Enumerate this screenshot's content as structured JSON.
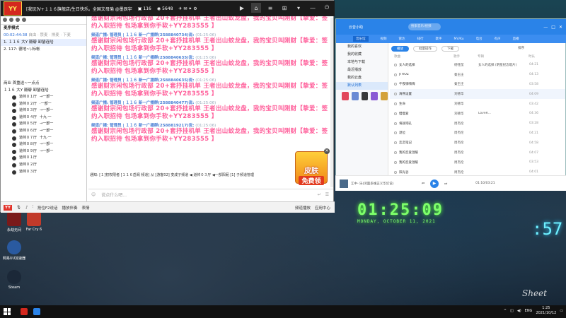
{
  "chat_window": {
    "title": "[我玩]V+１１６旗舰店/生日快乐。全国文母瑜 @墨辰宇",
    "online_count": "116",
    "viewer_count": "5648",
    "left_panel": {
      "header_label": "麦序模式",
      "timer": "00:02:44:38",
      "mode_text": "自由 · 禁麦 · 排麦 · 下麦",
      "queue": [
        {
          "num": "1.",
          "text": "１１６ 大Y  瓣瓣  卸瑟连哈"
        },
        {
          "num": "2.",
          "text": "117: 德地~\\-标帐"
        }
      ],
      "channel_header": "商业  首重送~一点点",
      "channel_item": "１１６ 大Y  瓣瓣  卸瑟连哈",
      "seats": [
        "道帅０１厅",
        "道帅０２厅",
        "道帅０３厅",
        "道帅０４厅",
        "道帅０５厅",
        "道帅０６厅",
        "道帅０７厅",
        "道帅０８厅",
        "道帅０９厅"
      ],
      "seats2": [
        "道帅０１厅",
        "道帅０２厅",
        "道帅０３厅"
      ],
      "seat_suffixes": [
        "→一部一",
        "·一部一",
        "→一部一",
        "十九·一",
        "→一部一",
        "→一部一",
        "十九·一",
        "→一部一",
        "→一部一"
      ]
    },
    "messages": [
      {
        "header": "频道广播: 管理员 | １１６  新一广播群(2588830736)说:",
        "time": "(01:25:06)",
        "body": "感谢财宗闲包场行政部 20+套抒挂机单 王者出山蚊龙盘，我的宝贝叫刚财【挚爱：签约入职招待 包场拿到你手软+YY283555 】"
      },
      {
        "header": "频道广播: 管理员 | １１６  新一广播群(2588840734)说:",
        "time": "(01:25:06)",
        "body": "感谢财宗闲包场行政部 20+套抒挂机单 王者出山蚊龙盘，我的宝贝叫刚财【挚爱：签约入职招待 包场拿到你手软+YY283555 】"
      },
      {
        "header": "频道广播: 管理员 | １１６  新一广播群(2588840635)说:",
        "time": "(01:25:06)",
        "body": "感谢财宗闲包场行政部 20+套抒挂机单 王者出山蚊龙盘，我的宝贝叫刚财【挚爱：签约入职招待 包场拿到你手软+YY283555 】"
      },
      {
        "header": "频道广播: 管理员 | １１６  新一广播群(2588840635)说:",
        "time": "(01:25:06)",
        "body": "感谢财宗闲包场行政部 20+套抒挂机单 王者出山蚊龙盘，我的宝贝叫刚财【挚爱：签约入职招待 包场拿到你手软+YY283555 】"
      },
      {
        "header": "频道广播: 管理员 | １１６  新一广播群(2588840477)说:",
        "time": "(01:25:06)",
        "body": "感谢财宗闲包场行政部 20+套抒挂机单 王者出山蚊龙盘，我的宝贝叫刚财【挚爱：签约入职招待 包场拿到你手软+YY283555 】"
      },
      {
        "header": "频道广播: 管理员 | １１６  新一广播群(2588819217)说:",
        "time": "(01:25:06)",
        "body": "感谢财宗闲包场行政部 20+套抒挂机单 王者出山蚊龙盘，我的宝贝叫刚财【挚爱：签约入职招待 包场拿到你手软+YY283555 】"
      }
    ],
    "system_line": "通知: [１]初权限者 [１１６岳阁 频道] 从 [游客02] 变成子频道   ◀   道帅０３厅  ◀一部阳厢  [1] 子频道管理",
    "promo": {
      "line1": "皮肤",
      "line2": "免费领"
    },
    "input_placeholder": "说点什么吧...",
    "bottom_bar": {
      "badge": "YY",
      "items": [
        "抢位F2说话",
        "播放伴奏",
        "表情"
      ],
      "right_items": [
        "频道播放",
        "应用中心"
      ]
    }
  },
  "desktop_icons": [
    {
      "label": "永劫无间",
      "color": "#7a1a1a"
    },
    {
      "label": "Far Cry 6",
      "color": "#c23a2a"
    },
    {
      "label": "网易UU加速器",
      "color": "#2a5aa0"
    },
    {
      "label": "Steam",
      "color": "#1b2838"
    }
  ],
  "clock_overlay": {
    "time": "01:25:09",
    "ampm": "AM",
    "date": "MONDAY, OCTOBER 11, 2021",
    "right": ":57"
  },
  "music_window": {
    "user": "云音小助",
    "search_placeholder": "搜索音乐/视频",
    "header_buttons": [
      "—",
      "□",
      "✕"
    ],
    "nav": [
      "音乐馆",
      "视频",
      "雷达",
      "排行",
      "歌手",
      "MV/Ku",
      "电台",
      "有声",
      "直播"
    ],
    "sidebar": [
      "我的喜欢",
      "我的收藏",
      "本地与下载",
      "最近播放",
      "我的云盘",
      "默认列表"
    ],
    "sidebar_selected": 5,
    "buttons": [
      "播放",
      "批量操作",
      "下载",
      "排序"
    ],
    "columns": [
      "歌曲",
      "歌手",
      "专辑",
      "时长"
    ],
    "songs": [
      {
        "title": "女人的选择",
        "artist": "杨钰莹",
        "album": "女人的选择 (明星纪念唱片)",
        "time": "04:21"
      },
      {
        "title": "JTROZ",
        "artist": "秦王庄",
        "album": "",
        "time": "04:13"
      },
      {
        "title": "午夜嗨嗨嗨",
        "artist": "秦王庄",
        "album": "",
        "time": "03:58"
      },
      {
        "title": "海燕设置",
        "artist": "刘德华",
        "album": "",
        "time": "04:09"
      },
      {
        "title": "生命",
        "artist": "刘德华",
        "album": "",
        "time": "03:42"
      },
      {
        "title": "慢慢爱",
        "artist": "刘德华",
        "album": "LoveR...",
        "time": "04:36"
      },
      {
        "title": "将就吧孔",
        "artist": "周杰伦",
        "album": "",
        "time": "03:28"
      },
      {
        "title": "退位",
        "artist": "周杰伦",
        "album": "",
        "time": "04:21"
      },
      {
        "title": "恋恋笔记",
        "artist": "周杰伦",
        "album": "",
        "time": "04:58"
      },
      {
        "title": "我的恋爱温暖",
        "artist": "周杰伦",
        "album": "",
        "time": "04:07"
      },
      {
        "title": "我的恋爱温暖",
        "artist": "周杰伦",
        "album": "",
        "time": "03:53"
      },
      {
        "title": "阳光谷",
        "artist": "周杰伦",
        "album": "",
        "time": "04:01"
      },
      {
        "title": "花园",
        "artist": "周杰伦",
        "album": "",
        "time": "04:33"
      }
    ],
    "player": {
      "song": "江中- 乐(闭面多维正义华幻说)",
      "elapsed": "01:10/03:21"
    }
  },
  "taskbar": {
    "lang": "ENG",
    "time": "1:25",
    "date": "2021/10/12"
  },
  "colors": {
    "broadcast_pink": "#ff5e9a",
    "header_blue": "#4a7fd4",
    "music_blue": "#2a83e8"
  }
}
